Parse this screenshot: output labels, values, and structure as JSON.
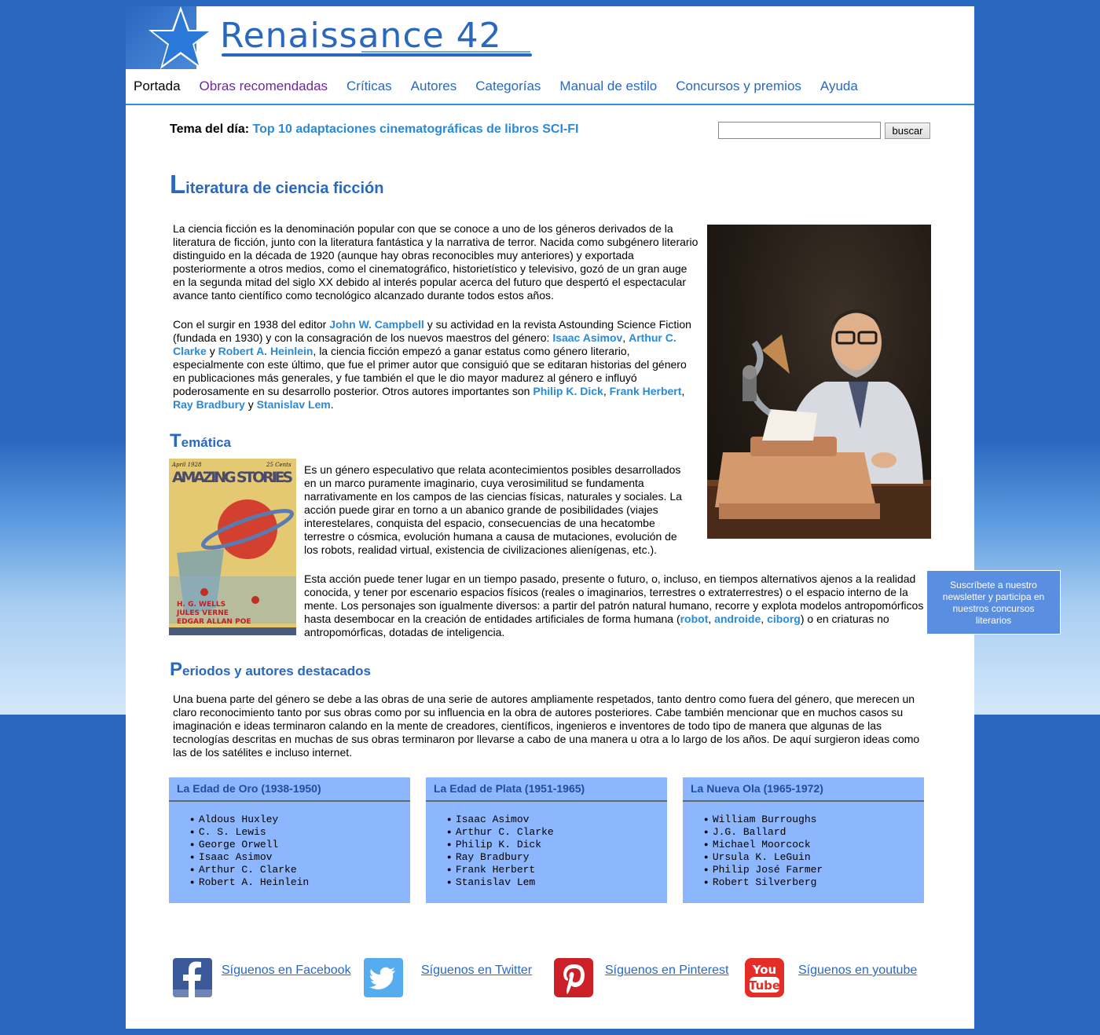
{
  "site": {
    "logo_text": "Renaissance 42"
  },
  "nav": {
    "items": [
      "Portada",
      "Obras recomendadas",
      "Críticas",
      "Autores",
      "Categorías",
      "Manual de estilo",
      "Concursos y premios",
      "Ayuda"
    ]
  },
  "topic": {
    "label": "Tema del día:",
    "link": "Top 10 adaptaciones cinematográficas de libros SCI-FI"
  },
  "search": {
    "value": "",
    "button_label": "buscar"
  },
  "article": {
    "title_cap": "L",
    "title_rest": "iteratura de ciencia ficción",
    "p1": "La ciencia ficción es la denominación popular con que se conoce a uno de los géneros derivados de la literatura de ficción, junto con la literatura fantástica y la narrativa de terror. Nacida como subgénero literario distinguido en la década de 1920 (aunque hay obras reconocibles muy anteriores) y exportada posteriormente a otros medios, como el cinematográfico, historietístico y televisivo, gozó de un gran auge en la segunda mitad del siglo XX debido al interés popular acerca del futuro que despertó el espectacular avance tanto científico como tecnológico alcanzado durante todos estos años.",
    "p2": {
      "t1": "Con el surgir en 1938 del editor ",
      "l1": "John W. Campbell",
      "t2": " y su actividad en la revista Astounding Science Fiction (fundada en 1930) y con la consagración de los nuevos maestros del género: ",
      "l2": "Isaac Asimov",
      "t3": ", ",
      "l3": "Arthur C. Clarke",
      "t4": " y ",
      "l4": "Robert A. Heinlein",
      "t5": ", la ciencia ficción empezó a ganar estatus como género literario, especialmente con este último, que fue el primer autor que consiguió que se editaran historias del género en publicaciones más generales, y fue también el que le dio mayor madurez al género e influyó poderosamente en su desarrollo posterior. Otros autores importantes son ",
      "l5": "Philip K. Dick",
      "t6": ", ",
      "l6": "Frank Herbert",
      "t7": ", ",
      "l7": "Ray Bradbury",
      "t8": " y ",
      "l8": "Stanislav Lem",
      "t9": "."
    },
    "tematica_cap": "T",
    "tematica_rest": "emática",
    "p3": "Es un género especulativo que relata acontecimientos posibles desarrollados en un marco puramente imaginario, cuya verosimilitud se fundamenta narrativamente en los campos de las ciencias físicas, naturales y sociales. La acción puede girar en torno a un abanico grande de posibilidades (viajes interestelares, conquista del espacio, consecuencias de una hecatombe terrestre o cósmica, evolución humana a causa de mutaciones, evolución de los robots, realidad virtual, existencia de civilizaciones alienígenas, etc.).",
    "p4": {
      "t1": "Esta acción puede tener lugar en un tiempo pasado, presente o futuro, o, incluso, en tiempos alternativos ajenos a la realidad conocida, y tener por escenario espacios físicos (reales o imaginarios, terrestres o extraterrestres) o el espacio interno de la mente. Los personajes son igualmente diversos: a partir del patrón natural humano, recorre y explota modelos antropomórficos hasta desembocar en la creación de entidades artificiales de forma humana (",
      "l1": "robot",
      "t2": ", ",
      "l2": "androide",
      "t3": ", ",
      "l3": "ciborg",
      "t4": ") o en criaturas no antropomórficas, dotadas de inteligencia."
    },
    "periodos_cap": "P",
    "periodos_rest": "eriodos y autores destacados",
    "p5": "Una buena parte del género se debe a las obras de una serie de autores ampliamente respetados, tanto dentro como fuera del género, que merecen un claro reconocimiento tanto por sus obras como por su influencia en la obra de autores posteriores. Cabe también mencionar que en muchos casos su imaginación e ideas terminaron calando en la mente de creadores, científicos, ingenieros e inventores de todo tipo de manera que algunas de las tecnologías descritas en muchas de sus obras terminaron por llevarse a cabo de una manera u otra a lo largo de los años. De aquí surgieron ideas como las de los satélites e incluso internet."
  },
  "cover": {
    "title": "AMAZING STORIES",
    "date": "April 1928",
    "price": "25 Cents",
    "authors": [
      "H. G. WELLS",
      "JULES VERNE",
      "EDGAR ALLAN POE"
    ]
  },
  "eras": [
    {
      "title": "La Edad de Oro (1938-1950)",
      "authors": [
        "Aldous Huxley",
        "C. S. Lewis",
        "George Orwell",
        "Isaac Asimov",
        "Arthur C. Clarke",
        "Robert A. Heinlein"
      ]
    },
    {
      "title": "La Edad de Plata (1951-1965)",
      "authors": [
        "Isaac Asimov",
        "Arthur C. Clarke",
        "Philip K. Dick",
        "Ray Bradbury",
        "Frank Herbert",
        "Stanislav Lem"
      ]
    },
    {
      "title": "La Nueva Ola (1965-1972)",
      "authors": [
        "William Burroughs",
        "J.G. Ballard",
        "Michael Moorcock",
        "Ursula K. LeGuin",
        "Philip José Farmer",
        "Robert Silverberg"
      ]
    }
  ],
  "social": [
    {
      "icon": "facebook-icon",
      "label": "Síguenos en Facebook",
      "color": "#3b5998"
    },
    {
      "icon": "twitter-icon",
      "label": "Síguenos en Twitter",
      "color": "#55acee"
    },
    {
      "icon": "pinterest-icon",
      "label": "Síguenos en Pinterest",
      "color": "#cb2027"
    },
    {
      "icon": "youtube-icon",
      "label": "Síguenos en youtube",
      "color": "#e52d27",
      "icon_text": [
        "You",
        "Tube"
      ]
    }
  ],
  "newsletter": {
    "text": "Suscríbete a nuestro newsletter y participa en nuestros concursos literarios"
  },
  "colors": {
    "brand": "#2a68c0",
    "link": "#2a8ad8",
    "era_box": "#8cb6fd"
  }
}
